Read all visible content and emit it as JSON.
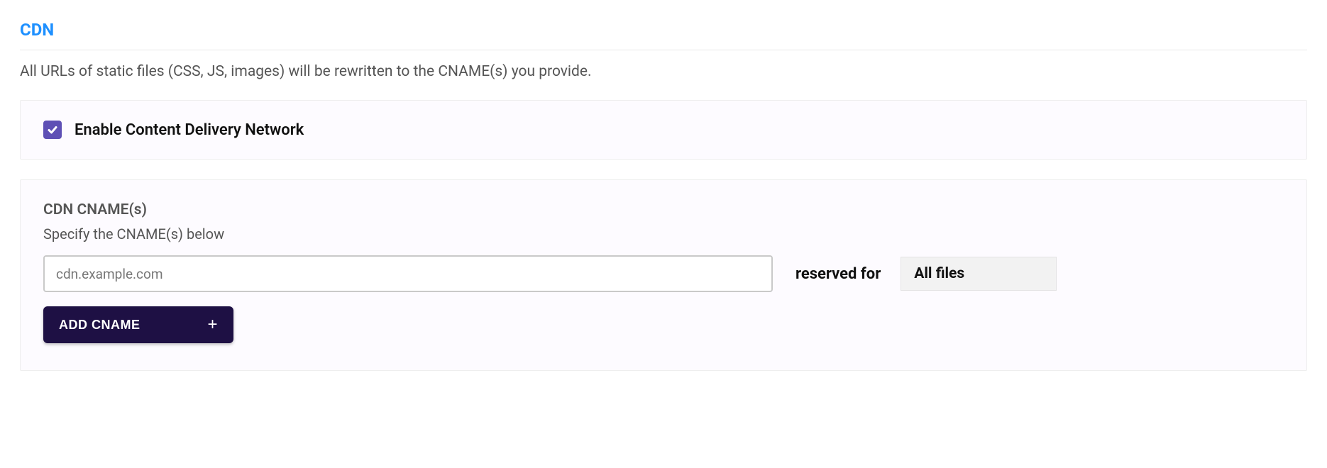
{
  "section": {
    "title": "CDN",
    "description": "All URLs of static files (CSS, JS, images) will be rewritten to the CNAME(s) you provide."
  },
  "enable": {
    "checked": true,
    "label": "Enable Content Delivery Network"
  },
  "cname": {
    "heading": "CDN CNAME(s)",
    "subtext": "Specify the CNAME(s) below",
    "placeholder": "cdn.example.com",
    "value": "",
    "reserved_label": "reserved for",
    "filter_selected": "All files",
    "add_button": "ADD CNAME"
  }
}
